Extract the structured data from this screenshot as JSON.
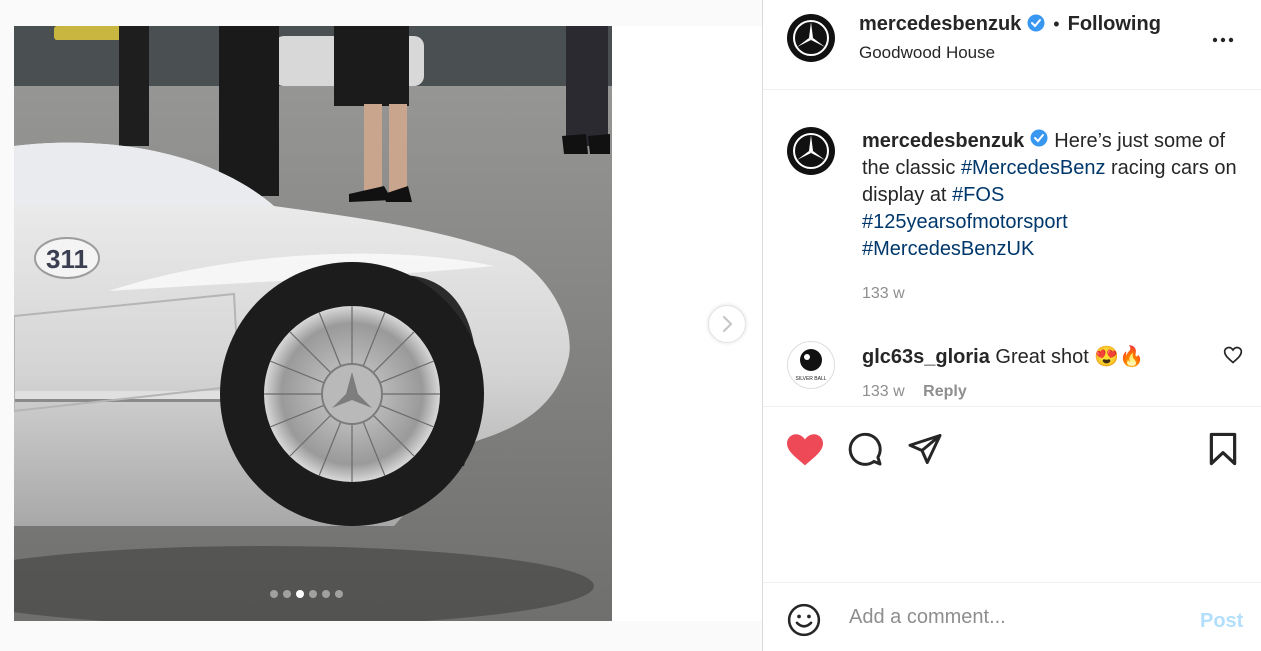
{
  "post": {
    "username": "mercedesbenzuk",
    "separator": "•",
    "follow_status": "Following",
    "location": "Goodwood House",
    "caption": {
      "text_before": "Here’s just some of the classic ",
      "hashtags": [
        "#MercedesBenz",
        "#FOS",
        "#125yearsofmotorsport",
        "#MercedesBenzUK"
      ],
      "text_middle": " racing cars on display at "
    },
    "time_ago": "133 w",
    "car_number": "311"
  },
  "comments": [
    {
      "username": "glc63s_gloria",
      "text": "Great shot",
      "emoji": "😍🔥",
      "meta_time": "133 w",
      "meta_reply": "Reply",
      "avatar_label": "SILVER BALL"
    }
  ],
  "add_comment": {
    "placeholder": "Add a comment...",
    "post_label": "Post"
  },
  "carousel": {
    "slides": 6,
    "active_index": 2
  },
  "colors": {
    "like": "#ed4956",
    "verified": "#3897f0",
    "hashtag": "#00376b",
    "post_disabled": "#b2dffc",
    "muted": "#8e8e8e"
  },
  "icons": [
    "heart-filled-icon",
    "comment-icon",
    "share-icon",
    "bookmark-icon",
    "emoji-icon",
    "more-icon",
    "next-arrow-icon",
    "verified-icon",
    "heart-outline-icon"
  ]
}
